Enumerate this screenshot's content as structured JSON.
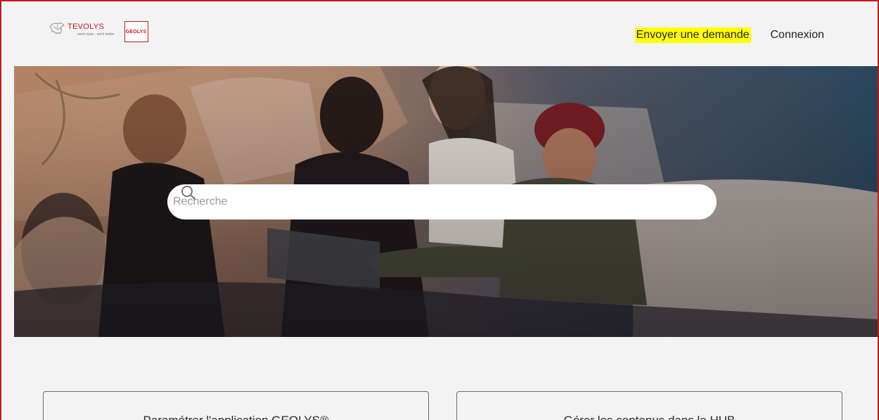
{
  "header": {
    "logo_tevolys": {
      "name": "TEVOLYS",
      "tagline": "work more · work better"
    },
    "logo_geolys": "GEOLYS",
    "nav": {
      "request_label": "Envoyer une demande",
      "login_label": "Connexion"
    }
  },
  "hero": {
    "image": "group-of-friends-laughing-on-sofa-photo",
    "search": {
      "placeholder": "Recherche",
      "icon": "search-icon"
    }
  },
  "cards": [
    {
      "label": "Paramétrer l'application GEOLYS®"
    },
    {
      "label": "Gérer les contenus dans le HUB"
    }
  ],
  "colors": {
    "brand_red": "#c0191f",
    "highlight": "#ffff00",
    "page_bg": "#f3f3f3"
  }
}
